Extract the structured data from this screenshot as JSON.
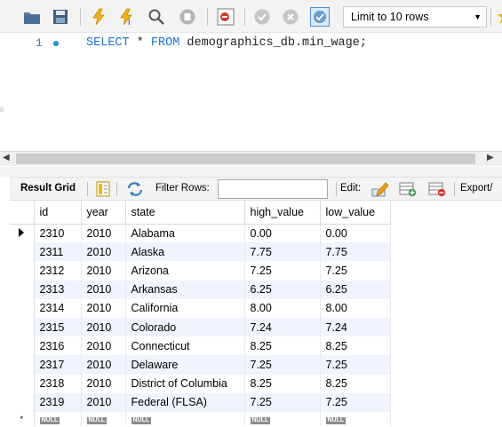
{
  "toolbar": {
    "limit_label": "Limit to 10 rows",
    "buttons": [
      "folder-icon",
      "save-icon",
      "execute-icon",
      "execute-current-icon",
      "explain-icon",
      "stop-icon",
      "toggle-continue-icon",
      "commit-icon",
      "rollback-icon",
      "autocommit-icon",
      "beautify-icon"
    ]
  },
  "editor": {
    "line_number": "1",
    "query": {
      "kw_select": "SELECT",
      "star": " * ",
      "kw_from": "FROM",
      "table": " demographics_db.min_wage;"
    }
  },
  "result_bar": {
    "result_grid_label": "Result Grid",
    "filter_label": "Filter Rows:",
    "filter_value": "",
    "edit_label": "Edit:",
    "export_label": "Export/"
  },
  "grid": {
    "columns": [
      "id",
      "year",
      "state",
      "high_value",
      "low_value"
    ],
    "rows": [
      [
        "2310",
        "2010",
        "Alabama",
        "0.00",
        "0.00"
      ],
      [
        "2311",
        "2010",
        "Alaska",
        "7.75",
        "7.75"
      ],
      [
        "2312",
        "2010",
        "Arizona",
        "7.25",
        "7.25"
      ],
      [
        "2313",
        "2010",
        "Arkansas",
        "6.25",
        "6.25"
      ],
      [
        "2314",
        "2010",
        "California",
        "8.00",
        "8.00"
      ],
      [
        "2315",
        "2010",
        "Colorado",
        "7.24",
        "7.24"
      ],
      [
        "2316",
        "2010",
        "Connecticut",
        "8.25",
        "8.25"
      ],
      [
        "2317",
        "2010",
        "Delaware",
        "7.25",
        "7.25"
      ],
      [
        "2318",
        "2010",
        "District of Columbia",
        "8.25",
        "8.25"
      ],
      [
        "2319",
        "2010",
        "Federal (FLSA)",
        "7.25",
        "7.25"
      ]
    ],
    "null_label": "NULL",
    "new_row_marker": "*"
  },
  "colors": {
    "keyword": "#1a73d9",
    "alt_row": "#f0f4ff",
    "toolbar_bg": "#f3f3f3"
  }
}
